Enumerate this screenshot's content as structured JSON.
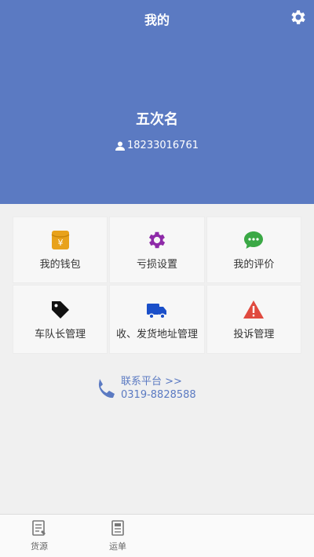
{
  "header": {
    "title": "我的",
    "settings_icon": "gear-icon",
    "user_name": "五次名",
    "phone": "18233016761",
    "bg_color": "#5b7ac2"
  },
  "menu": {
    "items": [
      {
        "label": "我的钱包",
        "icon": "wallet-icon",
        "color": "#e8a21b"
      },
      {
        "label": "亏损设置",
        "icon": "gear-icon",
        "color": "#8e2aa8"
      },
      {
        "label": "我的评价",
        "icon": "chat-icon",
        "color": "#3aa845"
      },
      {
        "label": "车队长管理",
        "icon": "tag-icon",
        "color": "#111111"
      },
      {
        "label": "收、发货地址管理",
        "icon": "truck-icon",
        "color": "#1a4fc9"
      },
      {
        "label": "投诉管理",
        "icon": "warning-icon",
        "color": "#e04a3f"
      }
    ]
  },
  "contact": {
    "label": "联系平台 >>",
    "phone": "0319-8828588",
    "icon": "phone-icon"
  },
  "tabbar": {
    "items": [
      {
        "label": "货源",
        "icon": "document-icon"
      },
      {
        "label": "运单",
        "icon": "waybill-icon"
      }
    ]
  }
}
